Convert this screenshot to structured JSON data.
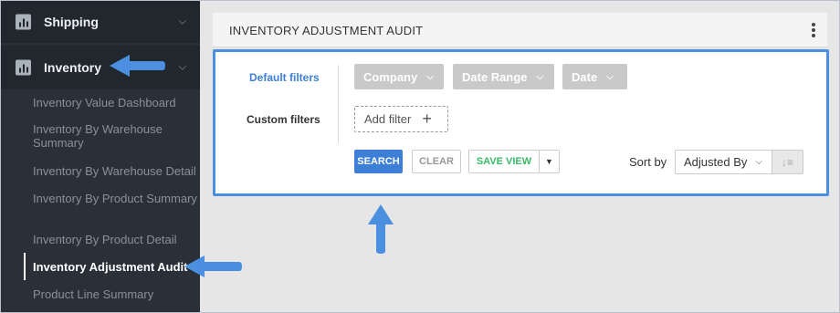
{
  "sidebar": {
    "sections": [
      {
        "label": "Shipping",
        "icon": "bar-chart-icon",
        "chevron": "chevron-down-icon"
      },
      {
        "label": "Inventory",
        "icon": "bar-chart-icon",
        "chevron": "chevron-down-icon"
      }
    ],
    "items": [
      {
        "label": "Inventory Value Dashboard"
      },
      {
        "label": "Inventory By Warehouse Summary"
      },
      {
        "label": "Inventory By Warehouse Detail"
      },
      {
        "label": "Inventory By Product Summary"
      },
      {
        "label": "Inventory By Product Detail"
      },
      {
        "label": "Inventory Adjustment Audit",
        "active": true
      },
      {
        "label": "Product Line Summary"
      }
    ]
  },
  "card": {
    "title": "INVENTORY ADJUSTMENT AUDIT",
    "menu_icon": "kebab-menu-icon"
  },
  "filters": {
    "default_label": "Default filters",
    "custom_label": "Custom filters",
    "chips": [
      {
        "label": "Company"
      },
      {
        "label": "Date Range"
      },
      {
        "label": "Date"
      }
    ],
    "add_filter": "Add filter",
    "add_filter_icon": "+"
  },
  "actions": {
    "search": "SEARCH",
    "clear": "CLEAR",
    "save_view": "SAVE VIEW"
  },
  "sort": {
    "label": "Sort by",
    "selected": "Adjusted By",
    "direction_icon": "sort-descending-icon"
  },
  "colors": {
    "sidebar_bg": "#2b3038",
    "accent_blue": "#3d7fd6",
    "highlight_border": "#4a8fe0",
    "save_green": "#3ab86a",
    "arrow_blue": "#4a8fe0"
  }
}
